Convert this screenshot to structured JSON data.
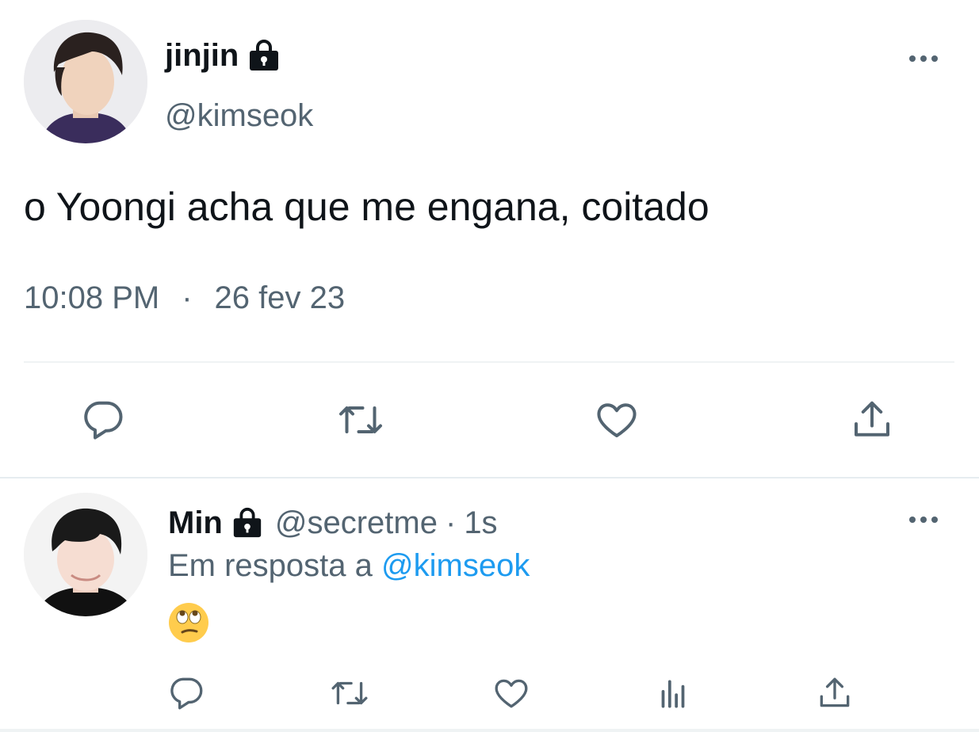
{
  "main_tweet": {
    "author_name": "jinjin",
    "handle": "@kimseok",
    "text": "o Yoongi acha que me engana, coitado",
    "time": "10:08 PM",
    "separator": "·",
    "date": "26 fev 23",
    "protected_icon": "lock-icon",
    "avatar": "profile-photo",
    "actions": [
      "reply-icon",
      "retweet-icon",
      "like-icon",
      "share-icon"
    ]
  },
  "reply_tweet": {
    "author_name": "Min",
    "handle": "@secretme",
    "separator": "·",
    "time": "1s",
    "replying_to_prefix": "Em resposta a",
    "replying_to_handle": "@kimseok",
    "emoji": "🙄",
    "protected_icon": "lock-icon",
    "avatar": "profile-photo",
    "actions": [
      "reply-icon",
      "retweet-icon",
      "like-icon",
      "analytics-icon",
      "share-icon"
    ]
  },
  "colors": {
    "text_primary": "#0f1419",
    "text_secondary": "#536471",
    "link": "#1d9bf0",
    "divider": "#eff3f4"
  }
}
